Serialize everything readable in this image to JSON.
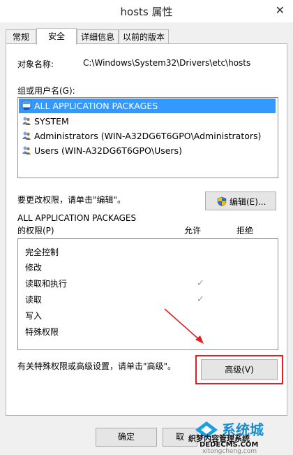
{
  "window": {
    "title": "hosts 属性",
    "close_glyph": "✕"
  },
  "tabs": [
    {
      "label": "常规",
      "active": false
    },
    {
      "label": "安全",
      "active": true
    },
    {
      "label": "详细信息",
      "active": false
    },
    {
      "label": "以前的版本",
      "active": false
    }
  ],
  "object_name": {
    "label": "对象名称:",
    "value": "C:\\Windows\\System32\\Drivers\\etc\\hosts"
  },
  "group_label": "组或用户名(G):",
  "groups": [
    {
      "name": "ALL APPLICATION PACKAGES",
      "icon": "app-packages-icon",
      "selected": true
    },
    {
      "name": "SYSTEM",
      "icon": "users-icon",
      "selected": false
    },
    {
      "name": "Administrators (WIN-A32DG6T6GPO\\Administrators)",
      "icon": "users-icon",
      "selected": false
    },
    {
      "name": "Users (WIN-A32DG6T6GPO\\Users)",
      "icon": "users-icon",
      "selected": false
    }
  ],
  "edit_hint": "要更改权限，请单击\"编辑\"。",
  "edit_button": {
    "label": "编辑(E)...",
    "icon": "shield-icon"
  },
  "perm_header": {
    "line1": "ALL APPLICATION PACKAGES",
    "line2": "的权限(P)",
    "allow": "允许",
    "deny": "拒绝"
  },
  "permissions": [
    {
      "name": "完全控制",
      "allow": false,
      "deny": false
    },
    {
      "name": "修改",
      "allow": false,
      "deny": false
    },
    {
      "name": "读取和执行",
      "allow": true,
      "deny": false
    },
    {
      "name": "读取",
      "allow": true,
      "deny": false
    },
    {
      "name": "写入",
      "allow": false,
      "deny": false
    },
    {
      "name": "特殊权限",
      "allow": false,
      "deny": false
    }
  ],
  "check_glyph": "✓",
  "advanced_hint": "有关特殊权限或高级设置，请单击\"高级\"。",
  "advanced_button": "高级(V)",
  "ok_button": "确定",
  "cancel_button_partial": "取",
  "watermark": {
    "logo_text": "系统城",
    "line1": "织梦内容管理系统",
    "line2": "DEDECMS.COM",
    "line3": "xitongcheng.com"
  },
  "colors": {
    "selection": "#3399ff",
    "annotation": "#e02020"
  }
}
